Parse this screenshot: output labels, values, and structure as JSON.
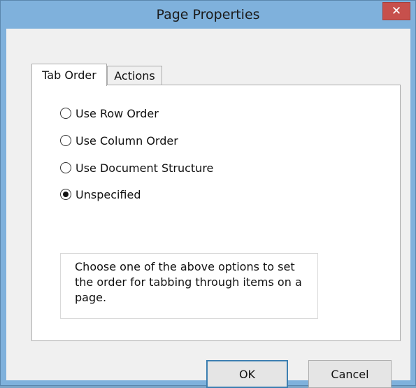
{
  "window": {
    "title": "Page Properties",
    "close_glyph": "✕"
  },
  "tabs": [
    {
      "label": "Tab Order",
      "active": true
    },
    {
      "label": "Actions",
      "active": false
    }
  ],
  "tab_order": {
    "options": [
      {
        "label": "Use Row Order",
        "checked": false
      },
      {
        "label": "Use Column Order",
        "checked": false
      },
      {
        "label": "Use Document Structure",
        "checked": false
      },
      {
        "label": "Unspecified",
        "checked": true
      }
    ],
    "help_text": "Choose one of the above options to set the order for tabbing through items on a page."
  },
  "buttons": {
    "ok_label": "OK",
    "cancel_label": "Cancel"
  },
  "colors": {
    "titlebar": "#7fb1dc",
    "close_button": "#c7504c",
    "default_button_border": "#3c7fb1"
  }
}
